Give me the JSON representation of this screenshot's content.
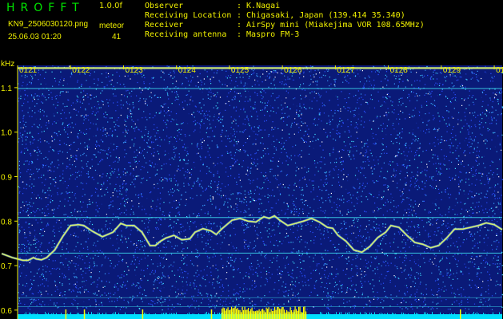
{
  "header": {
    "app_title": "HROFFT",
    "version": "1.0.0f",
    "file_name": "KN9_2506030120.png",
    "meteor_label": "meteor",
    "timestamp": "25.06.03 01:20",
    "meteor_count": "41",
    "info": [
      {
        "label": "Observer",
        "value": ": K.Nagai"
      },
      {
        "label": "Receiving Location",
        "value": ": Chigasaki, Japan (139.414 35.340)"
      },
      {
        "label": "Receiver",
        "value": ": AirSpy mini (Miakejima VOR 108.65MHz)"
      },
      {
        "label": "Receiving antenna",
        "value": ": Maspro FM-3"
      }
    ]
  },
  "colors": {
    "background": "#0a1a78",
    "grid": "#3fe0f0",
    "trace": "#d6f070",
    "speckle": [
      "#2a50ff",
      "#3aa0ff",
      "#40e0ff",
      "#ffffff",
      "#102a9a"
    ],
    "label": "#f0f000",
    "bottom_noise": "#00e0ff",
    "bottom_burst": "#ffff00"
  },
  "chart_data": {
    "type": "heatmap",
    "ylabel": "kHz",
    "x_ticks": [
      "0121",
      "0122",
      "0123",
      "0124",
      "0125",
      "0126",
      "0127",
      "0128",
      "0129",
      "0130"
    ],
    "x_range_minutes": [
      1,
      10.15
    ],
    "y_ticks": [
      "1.1",
      "1.0",
      "0.9",
      "0.8",
      "0.7",
      "0.6"
    ],
    "y_tick_values": [
      1.1,
      1.0,
      0.9,
      0.8,
      0.7,
      0.6
    ],
    "ylim": [
      0.58,
      1.15
    ],
    "horizontal_lines_khz": [
      1.144,
      1.098,
      0.808,
      0.728
    ],
    "strong_line_khz": 1.144,
    "trace": {
      "x": [
        0.7,
        0.9,
        1.1,
        1.2,
        1.3,
        1.35,
        1.45,
        1.55,
        1.7,
        1.85,
        2.0,
        2.15,
        2.25,
        2.4,
        2.6,
        2.8,
        2.95,
        3.05,
        3.2,
        3.35,
        3.5,
        3.6,
        3.7,
        3.8,
        3.95,
        4.1,
        4.25,
        4.35,
        4.5,
        4.65,
        4.75,
        4.85,
        4.95,
        5.05,
        5.2,
        5.35,
        5.5,
        5.65,
        5.75,
        5.85,
        5.95,
        6.1,
        6.25,
        6.4,
        6.55,
        6.7,
        6.85,
        6.95,
        7.05,
        7.2,
        7.35,
        7.5,
        7.65,
        7.8,
        7.95,
        8.05,
        8.2,
        8.35,
        8.5,
        8.65,
        8.8,
        8.95,
        9.1,
        9.25,
        9.4,
        9.55,
        9.7,
        9.85,
        10.0,
        10.15
      ],
      "y": [
        0.727,
        0.718,
        0.712,
        0.712,
        0.718,
        0.715,
        0.713,
        0.718,
        0.735,
        0.765,
        0.79,
        0.792,
        0.79,
        0.778,
        0.765,
        0.775,
        0.795,
        0.79,
        0.79,
        0.775,
        0.745,
        0.745,
        0.755,
        0.762,
        0.768,
        0.758,
        0.76,
        0.775,
        0.783,
        0.778,
        0.77,
        0.782,
        0.792,
        0.802,
        0.806,
        0.8,
        0.798,
        0.81,
        0.806,
        0.812,
        0.802,
        0.79,
        0.795,
        0.8,
        0.806,
        0.798,
        0.786,
        0.784,
        0.768,
        0.755,
        0.735,
        0.73,
        0.743,
        0.763,
        0.775,
        0.79,
        0.786,
        0.768,
        0.752,
        0.748,
        0.74,
        0.745,
        0.762,
        0.782,
        0.782,
        0.786,
        0.79,
        0.796,
        0.792,
        0.781
      ]
    }
  }
}
